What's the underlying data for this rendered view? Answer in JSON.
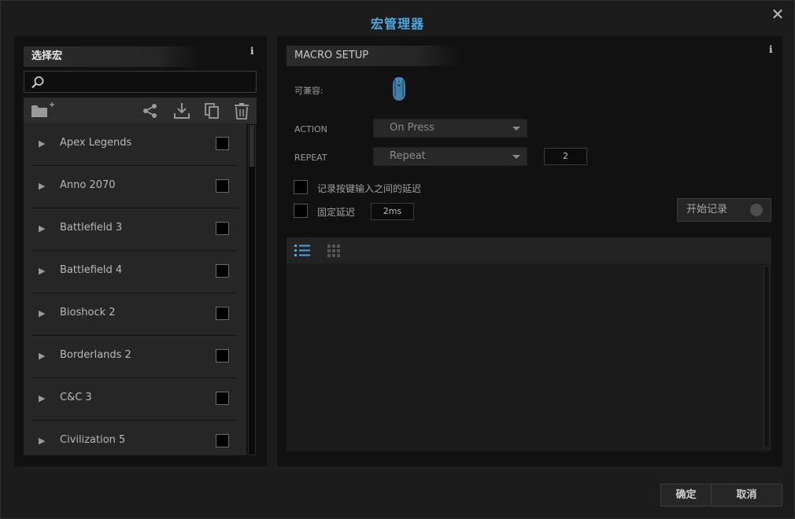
{
  "window": {
    "title": "宏管理器",
    "close": "✕"
  },
  "left_panel": {
    "header": "选择宏",
    "info": "i",
    "search": {
      "value": "",
      "placeholder": ""
    },
    "items": [
      {
        "label": "Apex Legends"
      },
      {
        "label": "Anno 2070"
      },
      {
        "label": "Battlefield 3"
      },
      {
        "label": "Battlefield 4"
      },
      {
        "label": "Bioshock 2"
      },
      {
        "label": "Borderlands 2"
      },
      {
        "label": "C&C 3"
      },
      {
        "label": "Civilization 5"
      }
    ]
  },
  "right_panel": {
    "header": "MACRO SETUP",
    "info": "i",
    "compatible_label": "可兼容:",
    "action_label": "ACTION",
    "action_value": "On Press",
    "repeat_label": "REPEAT",
    "repeat_value": "Repeat",
    "repeat_count": "2",
    "record_delay_label": "记录按键输入之间的延迟",
    "fixed_delay_label": "固定延迟",
    "fixed_delay_value": "2ms",
    "record_button": "开始记录"
  },
  "footer": {
    "ok": "确定",
    "cancel": "取消"
  },
  "colors": {
    "accent": "#4aa6e0",
    "background": "#1c1c1c",
    "panel": "#111111"
  }
}
